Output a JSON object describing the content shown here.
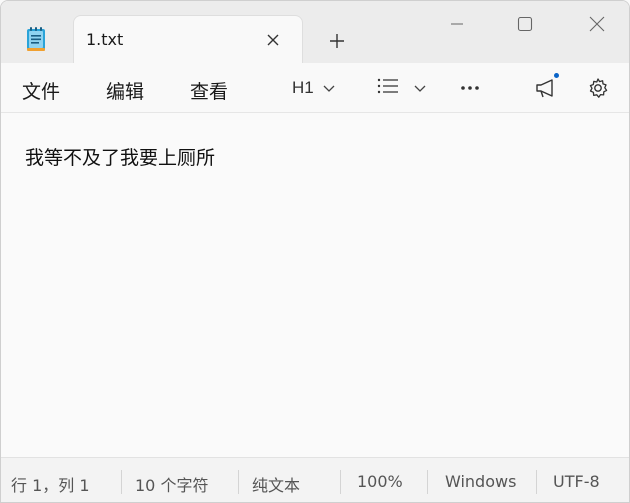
{
  "tab": {
    "title": "1.txt"
  },
  "menu": {
    "file": "文件",
    "edit": "编辑",
    "view": "查看"
  },
  "toolbar": {
    "heading": "H1"
  },
  "editor": {
    "content": "我等不及了我要上厕所"
  },
  "status": {
    "position": "行 1，列 1",
    "char_count": "10 个字符",
    "format": "纯文本",
    "zoom": "100%",
    "line_ending": "Windows",
    "encoding": "UTF-8"
  },
  "icons": {
    "app": "notepad-icon",
    "tab_close": "close-icon",
    "new_tab": "plus-icon",
    "minimize": "minimize-icon",
    "maximize": "maximize-icon",
    "close": "close-icon",
    "heading_chevron": "chevron-down-icon",
    "list": "bulleted-list-icon",
    "list_chevron": "chevron-down-icon",
    "more": "more-icon",
    "announce": "megaphone-icon",
    "settings": "gear-icon"
  },
  "colors": {
    "accent_dot": "#0a64c8",
    "titlebar_bg": "#ececec",
    "editor_bg": "#fafafa"
  }
}
